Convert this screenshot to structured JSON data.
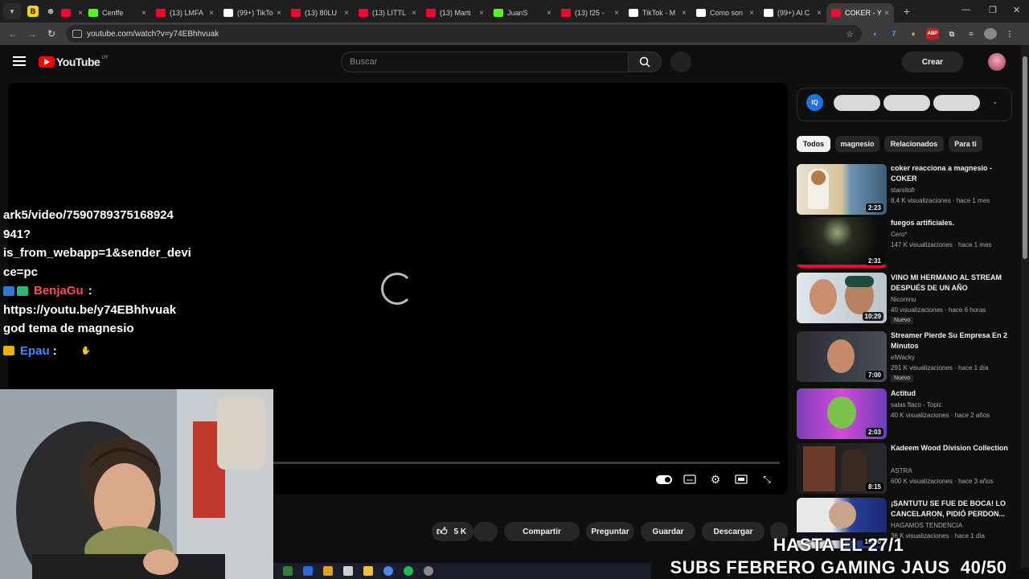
{
  "browser": {
    "tabs": [
      {
        "label": "",
        "icon": "youtube-icon",
        "color": "#ff0033"
      },
      {
        "label": "Cenffe",
        "icon": "kick-icon",
        "color": "#53fc18"
      },
      {
        "label": "(13) LMFA",
        "icon": "youtube-icon",
        "color": "#ff0033"
      },
      {
        "label": "(99+) TikTo",
        "icon": "tiktok-icon",
        "color": "#ffffff"
      },
      {
        "label": "(13) 80LU",
        "icon": "youtube-icon",
        "color": "#ff0033"
      },
      {
        "label": "(13) LITTL",
        "icon": "youtube-icon",
        "color": "#ff0033"
      },
      {
        "label": "(13) Marti",
        "icon": "youtube-icon",
        "color": "#ff0033"
      },
      {
        "label": "JuanS",
        "icon": "kick-icon",
        "color": "#53fc18"
      },
      {
        "label": "(13) f25 -",
        "icon": "youtube-icon",
        "color": "#ff0033"
      },
      {
        "label": "TikTok - M",
        "icon": "tiktok-icon",
        "color": "#ffffff"
      },
      {
        "label": "Como son",
        "icon": "tiktok-icon",
        "color": "#ffffff"
      },
      {
        "label": "(99+) Al C",
        "icon": "tiktok-icon",
        "color": "#ffffff"
      },
      {
        "label": "COKER - Y",
        "icon": "youtube-icon",
        "color": "#ff0033",
        "active": true
      }
    ],
    "url": "youtube.com/watch?v=y74EBhhvuak"
  },
  "masthead": {
    "logo_text": "YouTube",
    "country": "UY",
    "search_placeholder": "Buscar",
    "create_label": "Crear"
  },
  "chat": {
    "lines": [
      "ark5/video/7590789375168924",
      "941?",
      "is_from_webapp=1&sender_devi",
      "ce=pc"
    ],
    "user1": "BenjaGu",
    "user1_color": "#ff4d4d",
    "msg1_lines": [
      "https://youtu.be/y74EBhhvuak",
      "god tema de magnesio"
    ],
    "user2": "Epau",
    "user2_color": "#3b8cff",
    "colon": ":"
  },
  "actions": {
    "likes": "5 K",
    "share": "Compartir",
    "ask": "Preguntar",
    "save": "Guardar",
    "download": "Descargar"
  },
  "right": {
    "ad_logo": "IQ",
    "chips": [
      "Todos",
      "magnesio",
      "Relacionados",
      "Para ti"
    ],
    "recs": [
      {
        "title": "coker reacciona a magnesio - COKER",
        "channel": "starsitofr",
        "meta": "8,4 K visualizaciones · hace 1 mes",
        "duration": "2:23",
        "badge": ""
      },
      {
        "title": "fuegos artificiales.",
        "channel": "Cero*",
        "meta": "147 K visualizaciones · hace 1 mes",
        "duration": "2:31",
        "badge": ""
      },
      {
        "title": "VINO MI HERMANO AL STREAM DESPUÉS DE UN AÑO",
        "channel": "Nicomnu",
        "meta": "40 visualizaciones · hace 6 horas",
        "duration": "10:29",
        "badge": "Nuevo"
      },
      {
        "title": "Streamer Pierde Su Empresa En 2 Minutos",
        "channel": "elWacky",
        "meta": "291 K visualizaciones · hace 1 día",
        "duration": "7:00",
        "badge": "Nuevo"
      },
      {
        "title": "Actitud",
        "channel": "salas flaco - Topic",
        "meta": "40 K visualizaciones · hace 2 años",
        "duration": "2:03",
        "badge": ""
      },
      {
        "title": "Kadeem Wood Division Collection",
        "channel": "ASTRA",
        "meta": "600 K visualizaciones · hace 3 años",
        "duration": "8:15",
        "badge": ""
      },
      {
        "title": "¡SANTUTU SE FUE DE BOCA! LO CANCELARON, PIDIÓ PERDON...",
        "channel": "HAGAMOS TENDENCIA",
        "meta": "36 K visualizaciones · hace 1 día",
        "duration": "10:00",
        "badge": ""
      }
    ]
  },
  "overlay": {
    "line1": "HASTA EL 27/1",
    "line2": "SUBS FEBRERO GAMING JAUS",
    "count": "40/50"
  }
}
